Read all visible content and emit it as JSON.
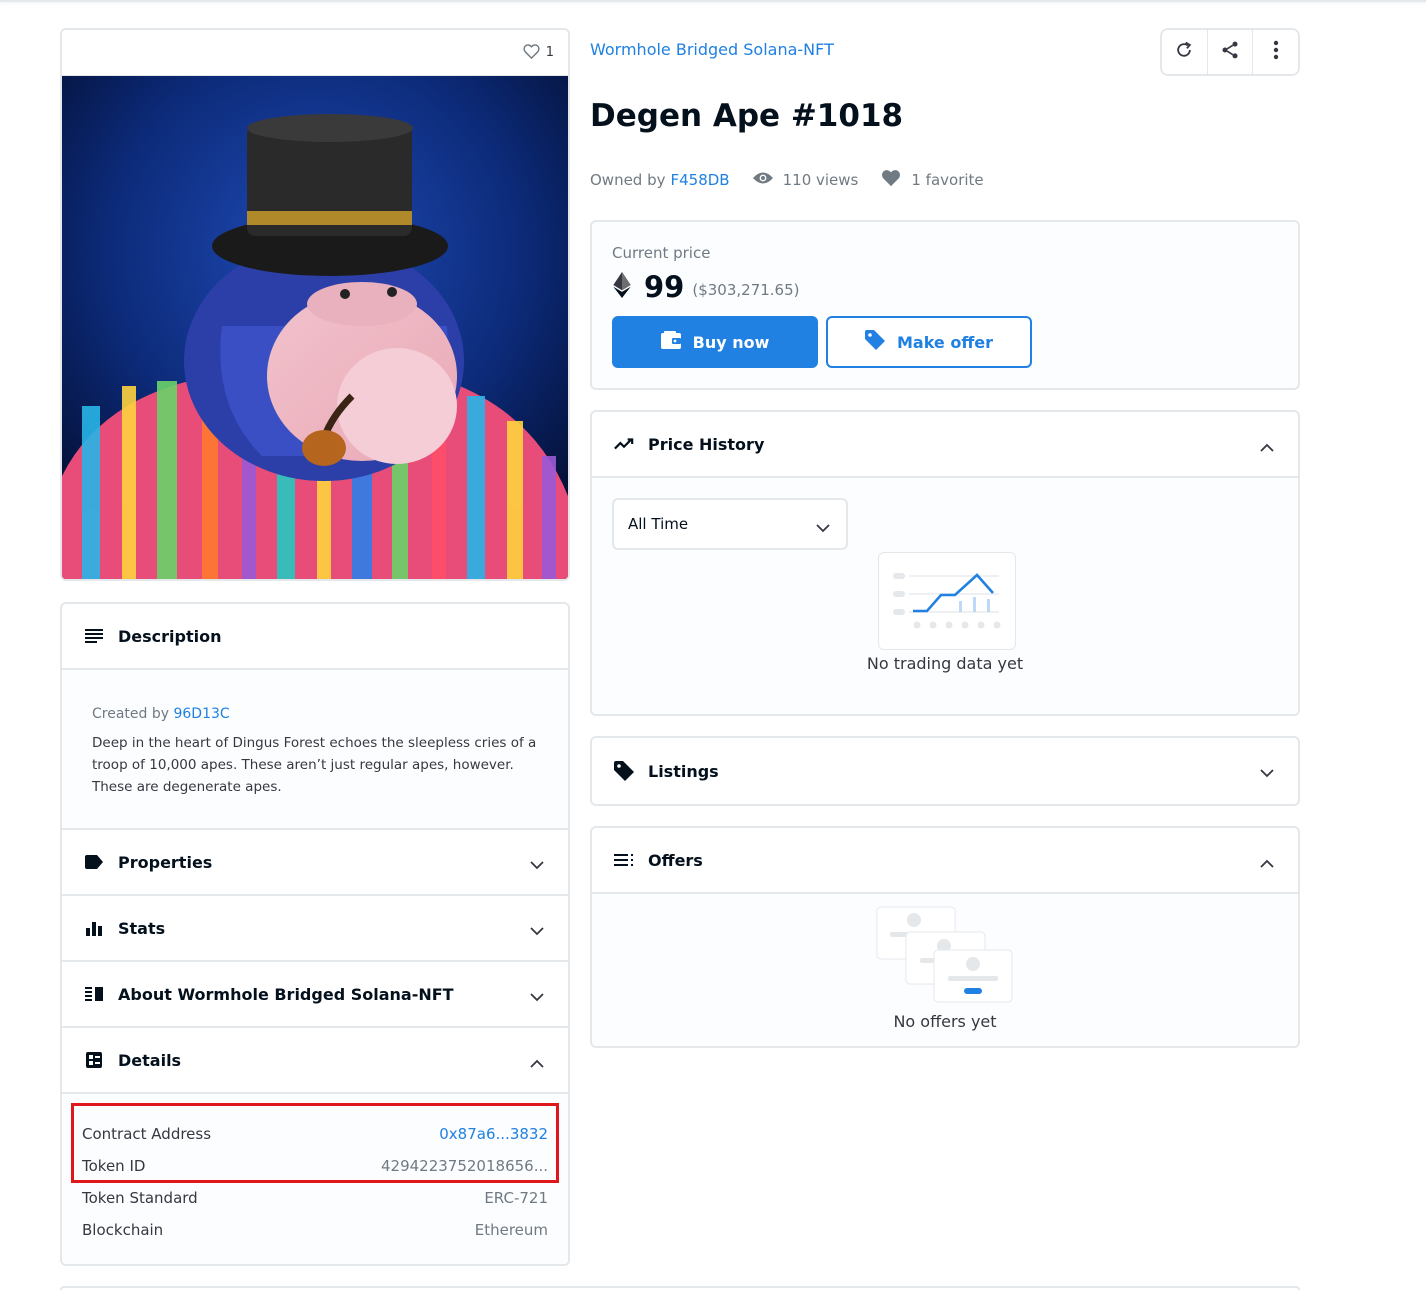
{
  "image_card": {
    "favorite_count": "1"
  },
  "collection": {
    "name": "Wormhole Bridged Solana-NFT"
  },
  "nft": {
    "title": "Degen Ape #1018",
    "owned_by_label": "Owned by",
    "owner": "F458DB",
    "views": "110 views",
    "favorites": "1 favorite"
  },
  "actions": {
    "icons": [
      "refresh-icon",
      "share-icon",
      "more-vertical-icon"
    ]
  },
  "price": {
    "label": "Current price",
    "amount": "99",
    "usd": "($303,271.65)",
    "currency_icon": "ethereum-icon",
    "buy_label": "Buy now",
    "offer_label": "Make offer"
  },
  "price_history": {
    "title": "Price History",
    "range": "All Time",
    "empty": "No trading data yet"
  },
  "listings": {
    "title": "Listings"
  },
  "offers": {
    "title": "Offers",
    "empty": "No offers yet"
  },
  "description": {
    "title": "Description",
    "created_by_label": "Created by",
    "creator": "96D13C",
    "text": "Deep in the heart of Dingus Forest echoes the sleepless cries of a troop of 10,000 apes. These aren’t just regular apes, however. These are degenerate apes."
  },
  "sections": {
    "properties": "Properties",
    "stats": "Stats",
    "about": "About Wormhole Bridged Solana-NFT",
    "details": "Details"
  },
  "details": {
    "contract_address_label": "Contract Address",
    "contract_address": "0x87a6...3832",
    "token_id_label": "Token ID",
    "token_id": "4294223752018656...",
    "token_standard_label": "Token Standard",
    "token_standard": "ERC-721",
    "blockchain_label": "Blockchain",
    "blockchain": "Ethereum"
  },
  "colors": {
    "accent": "#2081e2",
    "highlight": "#e0161d",
    "text": "#04111d",
    "muted": "#707a83"
  }
}
